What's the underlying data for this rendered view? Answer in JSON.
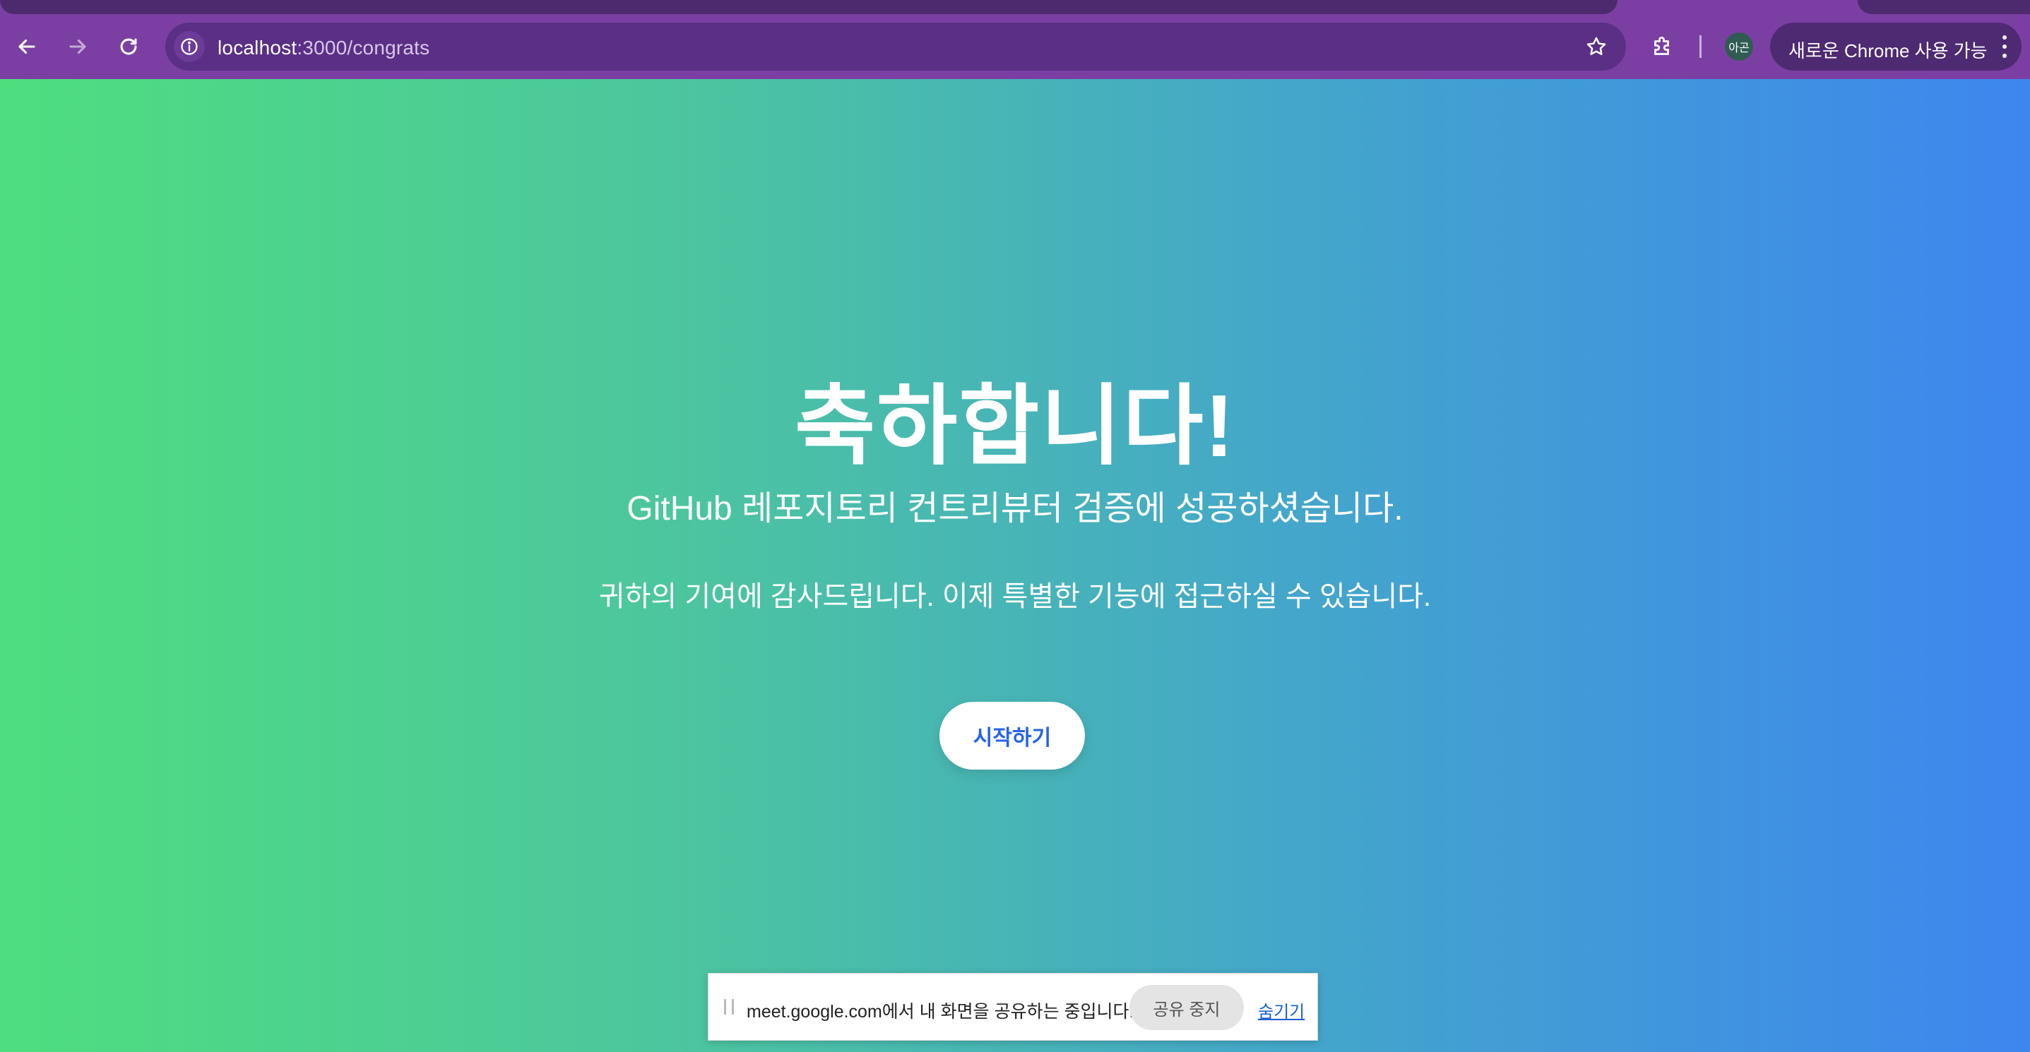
{
  "browser": {
    "url_host": "localhost",
    "url_path": ":3000/congrats",
    "profile_initials": "아곤",
    "update_label": "새로운 Chrome 사용 가능",
    "icons": {
      "back": "arrow-left-icon",
      "forward": "arrow-right-icon",
      "reload": "reload-icon",
      "site_info": "info-icon",
      "bookmark": "star-icon",
      "extensions": "puzzle-icon",
      "menu": "kebab-menu-icon"
    }
  },
  "page": {
    "heading": "축하합니다!",
    "subtitle": "GitHub 레포지토리 컨트리뷰터 검증에 성공하셨습니다.",
    "message": "귀하의 기여에 감사드립니다. 이제 특별한 기능에 접근하실 수 있습니다.",
    "start_button": "시작하기",
    "colors": {
      "gradient_start": "#4ede7f",
      "gradient_end": "#3d86ef",
      "button_text": "#2563eb"
    }
  },
  "share_bar": {
    "message": "meet.google.com에서 내 화면을 공유하는 중입니다.",
    "stop_label": "공유 중지",
    "hide_label": "숨기기"
  }
}
